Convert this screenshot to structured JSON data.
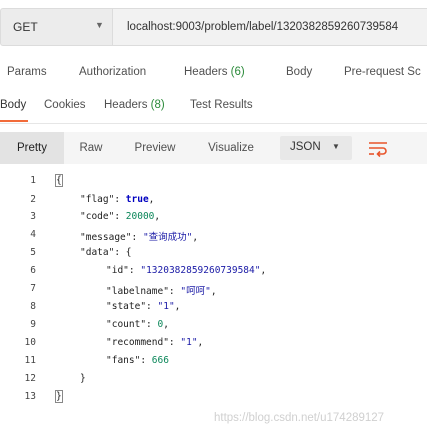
{
  "request": {
    "method": "GET",
    "url": "localhost:9003/problem/label/1320382859260739584"
  },
  "request_tabs": [
    {
      "label": "Params"
    },
    {
      "label": "Authorization"
    },
    {
      "label": "Headers",
      "count": "(6)"
    },
    {
      "label": "Body"
    },
    {
      "label": "Pre-request Sc"
    }
  ],
  "response_tabs": [
    {
      "label": "Body",
      "active": true
    },
    {
      "label": "Cookies"
    },
    {
      "label": "Headers",
      "count": "(8)"
    },
    {
      "label": "Test Results"
    }
  ],
  "format_bar": {
    "buttons": [
      "Pretty",
      "Raw",
      "Preview",
      "Visualize"
    ],
    "active": "Pretty",
    "language": "JSON"
  },
  "code": {
    "line_numbers": [
      "1",
      "2",
      "3",
      "4",
      "5",
      "6",
      "7",
      "8",
      "9",
      "10",
      "11",
      "12",
      "13"
    ],
    "open_brace": "{",
    "close_brace": "}",
    "flag_key": "\"flag\"",
    "flag_val": "true",
    "code_key": "\"code\"",
    "code_val": "20000",
    "message_key": "\"message\"",
    "message_val": "\"查询成功\"",
    "data_key": "\"data\"",
    "id_key": "\"id\"",
    "id_val": "\"1320382859260739584\"",
    "labelname_key": "\"labelname\"",
    "labelname_val": "\"呵呵\"",
    "state_key": "\"state\"",
    "state_val": "\"1\"",
    "count_key": "\"count\"",
    "count_val": "0",
    "recommend_key": "\"recommend\"",
    "recommend_val": "\"1\"",
    "fans_key": "\"fans\"",
    "fans_val": "666",
    "inner_close": "}"
  },
  "watermark": "https://blog.csdn.net/u174289127",
  "colors": {
    "accent_underline": "#f26b3a",
    "count_green": "#2a8a39",
    "wrap_icon": "#e8542b"
  }
}
